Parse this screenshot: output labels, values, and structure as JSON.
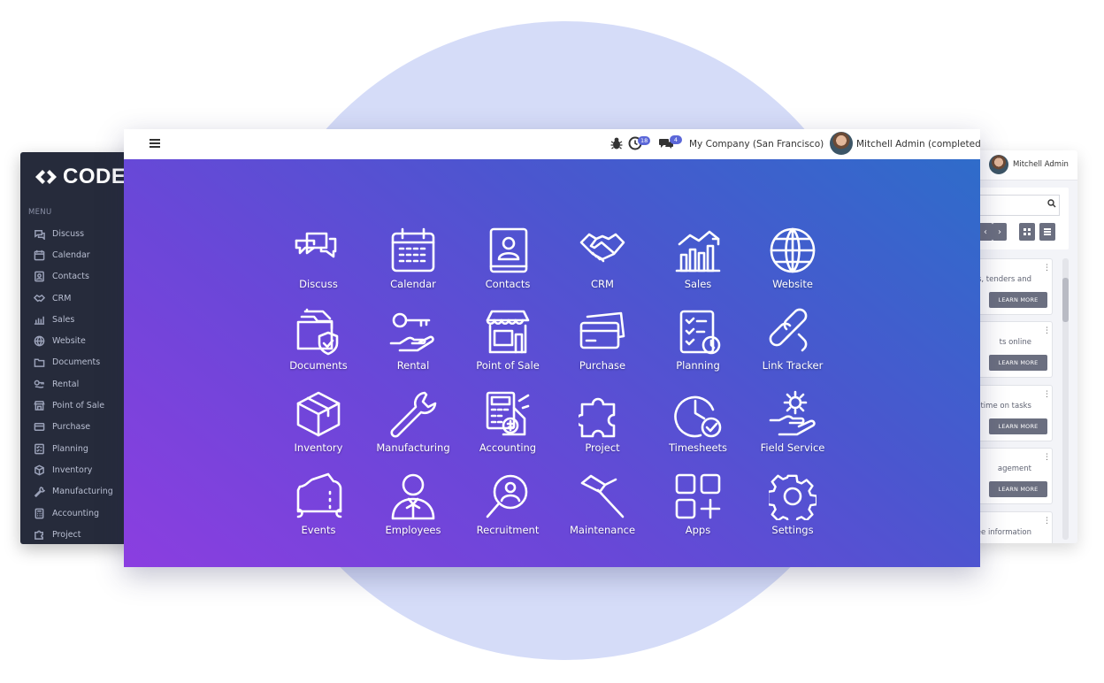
{
  "sidebar": {
    "logo_text": "CODE",
    "menu_label": "MENU",
    "items": [
      {
        "label": "Discuss",
        "icon": "chat-icon"
      },
      {
        "label": "Calendar",
        "icon": "calendar-icon"
      },
      {
        "label": "Contacts",
        "icon": "contact-icon"
      },
      {
        "label": "CRM",
        "icon": "handshake-icon"
      },
      {
        "label": "Sales",
        "icon": "chart-icon"
      },
      {
        "label": "Website",
        "icon": "globe-icon"
      },
      {
        "label": "Documents",
        "icon": "folder-icon"
      },
      {
        "label": "Rental",
        "icon": "key-icon"
      },
      {
        "label": "Point of Sale",
        "icon": "store-icon"
      },
      {
        "label": "Purchase",
        "icon": "card-icon"
      },
      {
        "label": "Planning",
        "icon": "checklist-icon"
      },
      {
        "label": "Inventory",
        "icon": "box-icon"
      },
      {
        "label": "Manufacturing",
        "icon": "wrench-icon"
      },
      {
        "label": "Accounting",
        "icon": "calculator-icon"
      },
      {
        "label": "Project",
        "icon": "puzzle-icon"
      }
    ]
  },
  "topbar": {
    "activity_count": "18",
    "message_count": "4",
    "company": "My Company (San Francisco)",
    "user": "Mitchell Admin (completed)"
  },
  "right_panel": {
    "user": "Mitchell Admin",
    "cards": [
      {
        "text": "s, tenders and",
        "button": "LEARN MORE"
      },
      {
        "text": "ts online",
        "button": "LEARN MORE"
      },
      {
        "text": "time on tasks",
        "button": "LEARN MORE"
      },
      {
        "text": "agement",
        "button": "LEARN MORE"
      },
      {
        "text": "oyee information",
        "button": ""
      }
    ]
  },
  "apps": [
    {
      "label": "Discuss",
      "icon": "discuss-icon"
    },
    {
      "label": "Calendar",
      "icon": "calendar-icon"
    },
    {
      "label": "Contacts",
      "icon": "contacts-icon"
    },
    {
      "label": "CRM",
      "icon": "handshake-icon"
    },
    {
      "label": "Sales",
      "icon": "sales-chart-icon"
    },
    {
      "label": "Website",
      "icon": "globe-icon"
    },
    {
      "label": "Documents",
      "icon": "documents-icon"
    },
    {
      "label": "Rental",
      "icon": "rental-key-icon"
    },
    {
      "label": "Point of Sale",
      "icon": "store-icon"
    },
    {
      "label": "Purchase",
      "icon": "credit-card-icon"
    },
    {
      "label": "Planning",
      "icon": "planning-checklist-icon"
    },
    {
      "label": "Link Tracker",
      "icon": "link-icon"
    },
    {
      "label": "Inventory",
      "icon": "box-icon"
    },
    {
      "label": "Manufacturing",
      "icon": "wrench-icon"
    },
    {
      "label": "Accounting",
      "icon": "calculator-icon"
    },
    {
      "label": "Project",
      "icon": "puzzle-icon"
    },
    {
      "label": "Timesheets",
      "icon": "timesheet-clock-icon"
    },
    {
      "label": "Field Service",
      "icon": "field-service-icon"
    },
    {
      "label": "Events",
      "icon": "ticket-icon"
    },
    {
      "label": "Employees",
      "icon": "employee-icon"
    },
    {
      "label": "Recruitment",
      "icon": "recruitment-search-icon"
    },
    {
      "label": "Maintenance",
      "icon": "hammer-icon"
    },
    {
      "label": "Apps",
      "icon": "apps-grid-icon"
    },
    {
      "label": "Settings",
      "icon": "gear-icon"
    }
  ],
  "colors": {
    "gradient_start": "#8b3ee0",
    "gradient_end": "#2f6cca",
    "sidebar_bg": "#262b3b",
    "badge": "#5b67d8",
    "circle": "#d5dcf8"
  }
}
